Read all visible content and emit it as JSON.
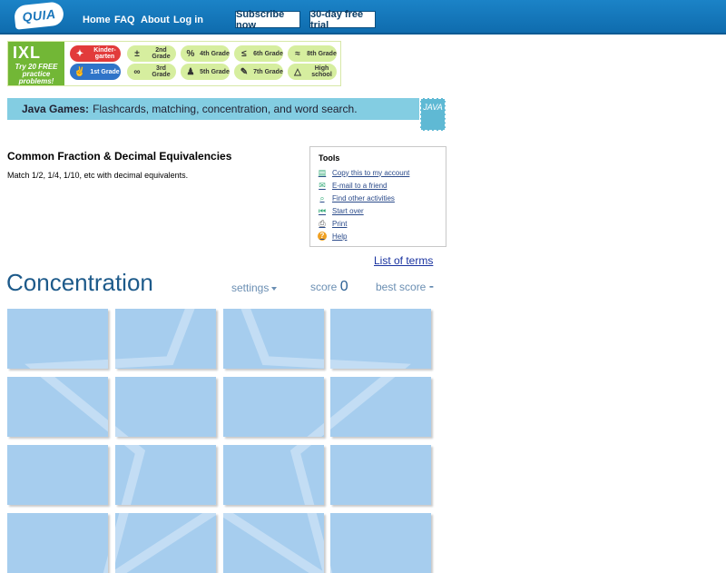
{
  "header": {
    "logo": "QUIA",
    "nav": [
      "Home",
      "FAQ",
      "About",
      "Log in"
    ],
    "subscribe": "Subscribe now",
    "trial": "30-day free trial"
  },
  "ixl": {
    "brand": "IXL",
    "promo": "Try 20 FREE practice problems!",
    "grades": [
      {
        "label": "Kinder-garten",
        "icon": "star-icon"
      },
      {
        "label": "2nd Grade",
        "icon": "plus-minus-icon"
      },
      {
        "label": "4th Grade",
        "icon": "percent-icon"
      },
      {
        "label": "6th Grade",
        "icon": "less-equal-icon"
      },
      {
        "label": "8th Grade",
        "icon": "approx-icon"
      },
      {
        "label": "1st Grade",
        "icon": "hand-icon"
      },
      {
        "label": "3rd Grade",
        "icon": "infinity-icon"
      },
      {
        "label": "5th Grade",
        "icon": "pawn-icon"
      },
      {
        "label": "7th Grade",
        "icon": "pencil-icon"
      },
      {
        "label": "High school",
        "icon": "triangle-icon"
      }
    ]
  },
  "java": {
    "bold": "Java Games:",
    "text": "Flashcards, matching, concentration, and word search.",
    "icon_text": "JAVA"
  },
  "activity": {
    "title": "Common Fraction & Decimal Equivalencies",
    "desc": "Match 1/2, 1/4, 1/10, etc with decimal equivalents."
  },
  "tools": {
    "title": "Tools",
    "items": [
      {
        "label": "Copy this to my account",
        "icon": "copy-icon"
      },
      {
        "label": "E-mail to a friend",
        "icon": "email-icon"
      },
      {
        "label": "Find other activities",
        "icon": "search-icon"
      },
      {
        "label": "Start over",
        "icon": "rewind-icon"
      },
      {
        "label": "Print",
        "icon": "print-icon"
      },
      {
        "label": "Help",
        "icon": "help-icon"
      }
    ]
  },
  "game": {
    "list_terms": "List of terms",
    "title": "Concentration",
    "settings": "settings",
    "score_label": "score",
    "score": "0",
    "best_label": "best score",
    "best": "-"
  },
  "colors": {
    "topbar": "#1b83c7",
    "card": "#a6cdee",
    "java_bar": "#83cde2",
    "ixl_green": "#72b736"
  }
}
